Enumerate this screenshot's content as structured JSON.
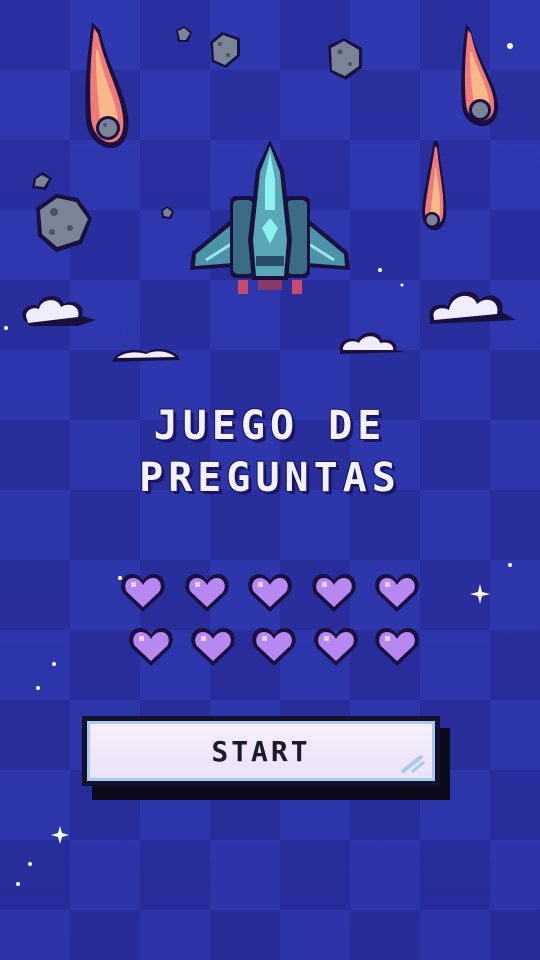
{
  "game": {
    "title_line1": "JUEGO DE",
    "title_line2": "PREGUNTAS",
    "start_label": "START"
  },
  "hearts": {
    "total": 10,
    "filled": 10,
    "color": "#b788f0"
  },
  "palette": {
    "background": "#2b32a6",
    "ship": "#3f8aa2",
    "meteor_fire": "#f07a7a",
    "cloud": "#f2ecff"
  }
}
